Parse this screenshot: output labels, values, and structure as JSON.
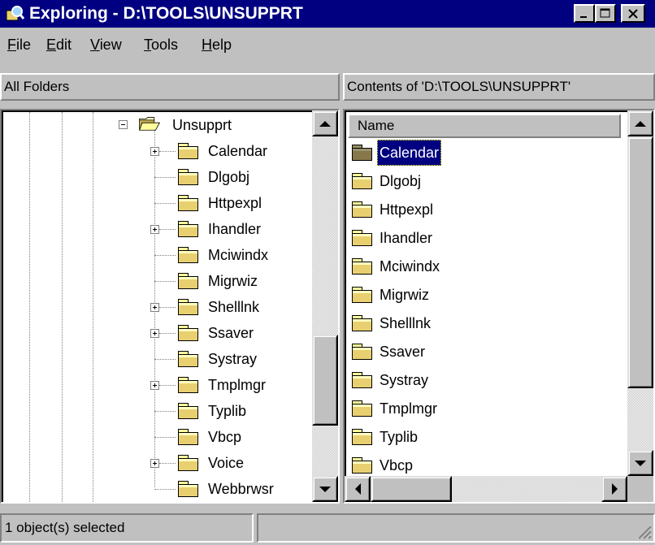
{
  "window": {
    "title": "Exploring - D:\\TOOLS\\UNSUPPRT",
    "icon": "explorer-magnifier-icon",
    "controls": [
      "minimize-icon",
      "maximize-icon",
      "close-icon"
    ]
  },
  "menu": {
    "items": [
      {
        "label": "File",
        "mnemonic": "F"
      },
      {
        "label": "Edit",
        "mnemonic": "E"
      },
      {
        "label": "View",
        "mnemonic": "V"
      },
      {
        "label": "Tools",
        "mnemonic": "T"
      },
      {
        "label": "Help",
        "mnemonic": "H"
      }
    ]
  },
  "tree": {
    "header": "All Folders",
    "parent": {
      "label": "Unsupprt",
      "expanded": true,
      "icon": "open-folder-icon"
    },
    "items": [
      {
        "label": "Calendar",
        "expandable": true
      },
      {
        "label": "Dlgobj",
        "expandable": false
      },
      {
        "label": "Httpexpl",
        "expandable": false
      },
      {
        "label": "Ihandler",
        "expandable": true
      },
      {
        "label": "Mciwindx",
        "expandable": false
      },
      {
        "label": "Migrwiz",
        "expandable": false
      },
      {
        "label": "Shelllnk",
        "expandable": true
      },
      {
        "label": "Ssaver",
        "expandable": true
      },
      {
        "label": "Systray",
        "expandable": false
      },
      {
        "label": "Tmplmgr",
        "expandable": true
      },
      {
        "label": "Typlib",
        "expandable": false
      },
      {
        "label": "Vbcp",
        "expandable": false
      },
      {
        "label": "Voice",
        "expandable": true
      },
      {
        "label": "Webbrwsr",
        "expandable": false
      }
    ]
  },
  "contents": {
    "header": "Contents of 'D:\\TOOLS\\UNSUPPRT'",
    "column_name": "Name",
    "selected": "Calendar",
    "items": [
      "Calendar",
      "Dlgobj",
      "Httpexpl",
      "Ihandler",
      "Mciwindx",
      "Migrwiz",
      "Shelllnk",
      "Ssaver",
      "Systray",
      "Tmplmgr",
      "Typlib",
      "Vbcp"
    ]
  },
  "status": {
    "left": "1 object(s) selected",
    "right": ""
  },
  "colors": {
    "titlebar": "#000080",
    "face": "#c0c0c0",
    "selection": "#000080",
    "folder": "#e8d070"
  }
}
